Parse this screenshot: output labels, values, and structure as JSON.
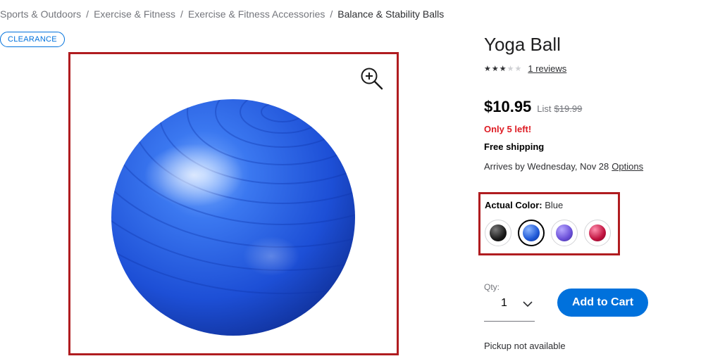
{
  "breadcrumb": {
    "items": [
      "Sports & Outdoors",
      "Exercise & Fitness",
      "Exercise & Fitness Accessories",
      "Balance & Stability Balls"
    ],
    "separator": "/"
  },
  "badge": {
    "label": "CLEARANCE"
  },
  "product": {
    "title": "Yoga Ball",
    "rating": {
      "stars": 3,
      "max": 5,
      "reviews_label": "1 reviews"
    },
    "price": "$10.95",
    "list_label": "List",
    "list_price": "$19.99",
    "stock_text": "Only 5 left!",
    "shipping_text": "Free shipping",
    "arrival_text": "Arrives by Wednesday, Nov 28",
    "options_link": "Options",
    "image_color": "#1e4fd8"
  },
  "color_selector": {
    "label": "Actual Color:",
    "selected": "Blue",
    "swatches": [
      {
        "name": "Black",
        "color": "#1a1a1a",
        "selected": false
      },
      {
        "name": "Blue",
        "color": "#1e58d6",
        "selected": true
      },
      {
        "name": "Purple",
        "color": "#6a4fd8",
        "selected": false
      },
      {
        "name": "Red",
        "color": "#c0123e",
        "selected": false
      }
    ]
  },
  "quantity": {
    "label": "Qty:",
    "value": "1"
  },
  "cart_button": {
    "label": "Add to Cart",
    "color": "#0071dc"
  },
  "pickup_text": "Pickup not available",
  "icons": {
    "zoom": "zoom-in-icon",
    "chevron": "chevron-down-icon"
  }
}
